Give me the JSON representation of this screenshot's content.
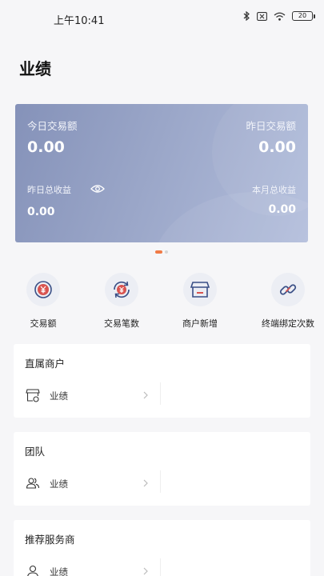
{
  "status_bar": {
    "time": "上午10:41",
    "battery": "20"
  },
  "page": {
    "title": "业绩"
  },
  "stats_card": {
    "today_label": "今日交易额",
    "today_value": "0.00",
    "yesterday_label": "昨日交易额",
    "yesterday_value": "0.00",
    "yesterday_income_label": "昨日总收益",
    "yesterday_income_value": "0.00",
    "month_income_label": "本月总收益",
    "month_income_value": "0.00"
  },
  "pager": {
    "count": 2,
    "active": 0
  },
  "shortcuts": [
    {
      "label": "交易额",
      "icon": "yen-circle-icon"
    },
    {
      "label": "交易笔数",
      "icon": "yen-refresh-icon"
    },
    {
      "label": "商户新增",
      "icon": "store-icon"
    },
    {
      "label": "终端绑定次数",
      "icon": "link-icon"
    }
  ],
  "sections": [
    {
      "title": "直属商户",
      "row_label": "业绩",
      "icon": "store-outline-icon"
    },
    {
      "title": "团队",
      "row_label": "业绩",
      "icon": "team-icon"
    },
    {
      "title": "推荐服务商",
      "row_label": "业绩",
      "icon": "person-icon"
    }
  ],
  "colors": {
    "accent": "#f07a46",
    "card_start": "#8592b9",
    "card_end": "#b3bedc",
    "icon_red": "#d9534f",
    "icon_blue": "#3a4f86"
  }
}
